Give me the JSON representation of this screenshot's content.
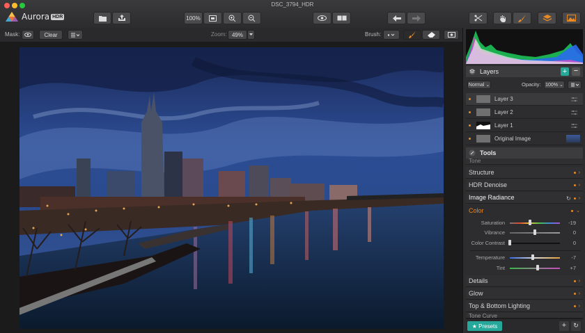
{
  "window": {
    "title": "DSC_3794_HDR"
  },
  "app": {
    "name": "Aurora",
    "badge": "HDR"
  },
  "toolbar": {
    "zoom_fit_label": "100%",
    "open_icon": "folder-icon",
    "share_icon": "share-icon",
    "fit_icon": "fit-screen-icon",
    "zoom_in_icon": "zoom-in-icon",
    "zoom_out_icon": "zoom-out-icon",
    "preview_icon": "eye-icon",
    "compare_icon": "split-view-icon",
    "undo_icon": "undo-arrow-icon",
    "redo_icon": "redo-arrow-icon",
    "crop_icon": "crop-icon",
    "hand_icon": "hand-icon",
    "brush_icon": "brush-icon",
    "layers_icon": "layers-icon",
    "image_icon": "landscape-icon"
  },
  "options": {
    "mask_label": "Mask:",
    "clear_label": "Clear",
    "zoom_label": "Zoom:",
    "zoom_value": "49%",
    "brush_label": "Brush:"
  },
  "layers": {
    "title": "Layers",
    "blend_mode": "Normal",
    "opacity_label": "Opacity:",
    "opacity_value": "100%",
    "items": [
      {
        "name": "Layer 3"
      },
      {
        "name": "Layer 2"
      },
      {
        "name": "Layer 1"
      },
      {
        "name": "Original Image"
      }
    ]
  },
  "tools": {
    "title": "Tools",
    "partial_top": "Tone",
    "items": [
      "Structure",
      "HDR Denoise",
      "Image Radiance",
      "Color",
      "Details",
      "Glow",
      "Top & Bottom Lighting"
    ],
    "partial_bottom": "Tone Curve",
    "color_sliders": [
      {
        "label": "Saturation",
        "value": "-19",
        "pos": 0.37
      },
      {
        "label": "Vibrance",
        "value": "0",
        "pos": 0.5
      },
      {
        "label": "Color Contrast",
        "value": "0",
        "pos": 0.0
      },
      {
        "label": "Temperature",
        "value": "-7",
        "pos": 0.45
      },
      {
        "label": "Tint",
        "value": "+7",
        "pos": 0.55
      }
    ]
  },
  "footer": {
    "presets_label": "★ Presets"
  },
  "colors": {
    "accent": "#e98a24",
    "teal": "#25a89a"
  }
}
